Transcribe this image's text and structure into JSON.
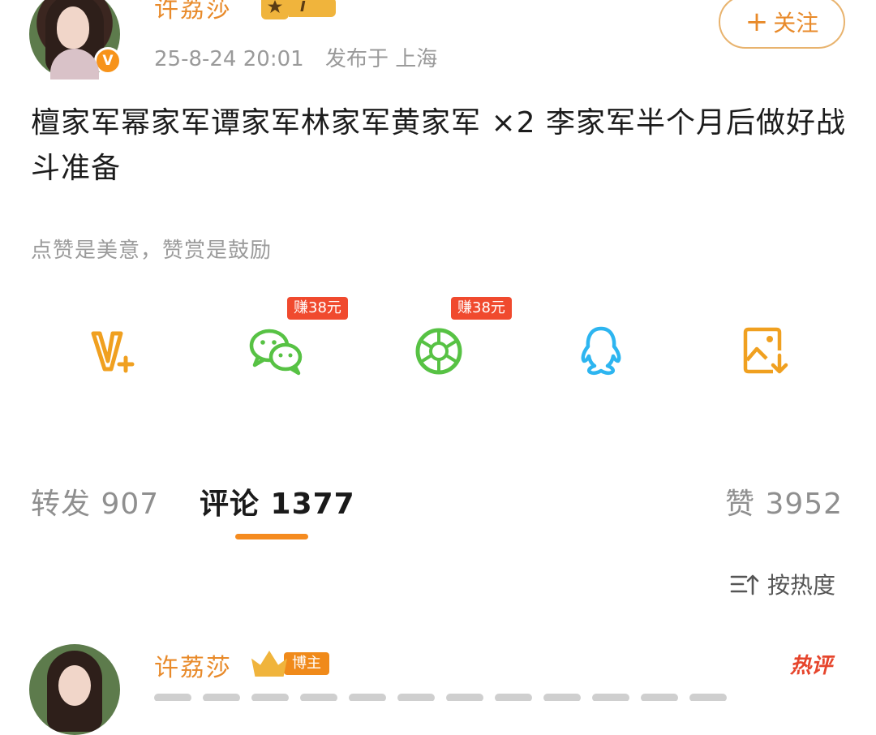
{
  "post": {
    "author": "许荔莎",
    "level_badge": "I",
    "time": "25-8-24 20:01",
    "location": "发布于 上海",
    "follow_label": "关注",
    "content": "檀家军幂家军谭家军林家军黄家军 ×2 李家军半个月后做好战斗准备",
    "tip": "点赞是美意，赞赏是鼓励"
  },
  "share": {
    "items": [
      {
        "icon": "vplus-icon",
        "color": "#f0a020"
      },
      {
        "icon": "wechat-icon",
        "color": "#57c244",
        "tag": "赚38元"
      },
      {
        "icon": "moments-icon",
        "color": "#57c244",
        "tag": "赚38元"
      },
      {
        "icon": "qq-icon",
        "color": "#2db5f0"
      },
      {
        "icon": "save-image-icon",
        "color": "#f0a020"
      }
    ]
  },
  "tabs": {
    "repost": "转发 907",
    "comments": "评论 1377",
    "likes": "赞 3952"
  },
  "sort": {
    "label": "按热度"
  },
  "comment": {
    "author": "许荔莎",
    "badge": "博主",
    "hot_label": "热评"
  },
  "colors": {
    "accent": "#f58b1f",
    "username": "#e88a2a",
    "tag": "#f04a2e"
  }
}
